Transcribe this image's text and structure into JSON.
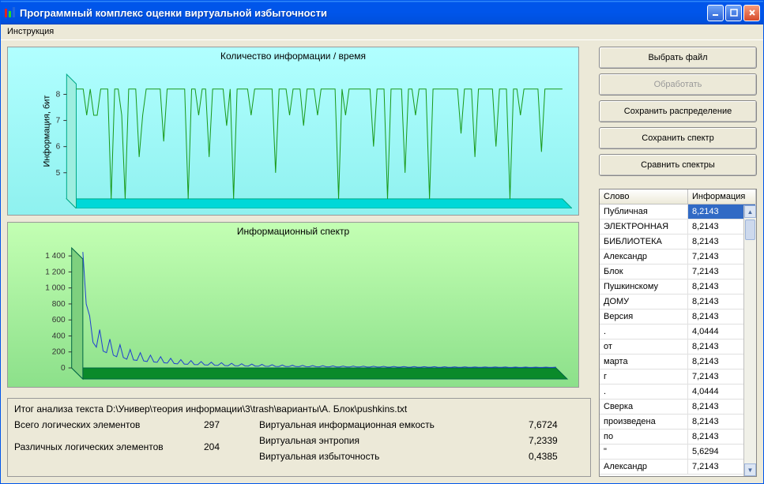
{
  "window": {
    "title": "Программный комплекс оценки виртуальной избыточности"
  },
  "menu": {
    "item1": "Инструкция"
  },
  "chart1": {
    "title": "Количество информации / время",
    "ylabel": "Информация, бит",
    "yticks": [
      "5",
      "6",
      "7",
      "8"
    ]
  },
  "chart2": {
    "title": "Информационный спектр",
    "yticks": [
      "0",
      "200",
      "400",
      "600",
      "800",
      "1 000",
      "1 200",
      "1 400"
    ]
  },
  "chart_data": [
    {
      "type": "line",
      "title": "Количество информации / время",
      "ylabel": "Информация, бит",
      "ylim": [
        4.0,
        8.4
      ],
      "values": [
        8.2,
        8.2,
        8.2,
        7.2,
        8.2,
        7.2,
        7.2,
        8.2,
        8.2,
        8.2,
        4.0,
        8.2,
        8.2,
        7.2,
        4.0,
        8.2,
        8.2,
        8.2,
        5.6,
        7.2,
        8.2,
        8.2,
        8.2,
        8.2,
        8.2,
        6.2,
        8.2,
        8.2,
        8.2,
        8.2,
        8.2,
        8.2,
        4.0,
        8.2,
        8.2,
        7.2,
        8.2,
        8.2,
        5.6,
        8.2,
        8.2,
        8.2,
        8.2,
        6.8,
        8.2,
        4.0,
        8.2,
        8.2,
        8.2,
        8.2,
        7.2,
        8.2,
        8.2,
        8.2,
        8.2,
        8.2,
        8.2,
        5.0,
        8.2,
        8.2,
        8.2,
        7.2,
        8.2,
        8.2,
        8.2,
        6.8,
        8.2,
        8.2,
        8.2,
        7.2,
        8.2,
        8.2,
        8.2,
        8.2,
        8.2,
        4.0,
        8.2,
        7.2,
        8.2,
        8.2,
        8.2,
        8.2,
        8.2,
        8.2,
        8.2,
        6.0,
        8.2,
        8.2,
        8.2,
        4.0,
        8.2,
        8.2,
        8.2,
        8.2,
        5.0,
        8.2,
        8.2,
        7.2,
        8.2,
        8.2,
        8.2,
        4.0,
        8.2,
        8.2,
        8.2,
        8.2,
        8.2,
        8.2,
        8.2,
        8.2,
        6.5,
        8.2,
        8.2,
        8.2,
        5.6,
        8.2,
        8.2,
        8.2,
        8.2,
        8.2,
        6.0,
        8.2,
        8.2,
        8.2,
        4.0,
        8.2,
        8.2,
        7.2,
        8.2,
        8.2,
        8.2,
        8.2,
        8.2,
        5.8,
        8.2,
        8.2,
        8.2,
        8.2,
        8.2,
        8.2
      ]
    },
    {
      "type": "line",
      "title": "Информационный спектр",
      "ylim": [
        0,
        1500
      ],
      "values": [
        1450,
        800,
        650,
        320,
        260,
        480,
        210,
        190,
        360,
        160,
        140,
        290,
        130,
        110,
        230,
        100,
        95,
        190,
        88,
        80,
        160,
        75,
        70,
        140,
        65,
        60,
        120,
        55,
        50,
        105,
        48,
        45,
        92,
        42,
        40,
        80,
        38,
        36,
        72,
        34,
        32,
        65,
        30,
        28,
        58,
        27,
        26,
        52,
        25,
        24,
        48,
        23,
        22,
        44,
        21,
        20,
        40,
        19,
        18,
        37,
        18,
        17,
        34,
        17,
        16,
        32,
        16,
        15,
        30,
        15,
        14,
        28,
        14,
        14,
        26,
        13,
        13,
        24,
        13,
        12,
        23,
        12,
        12,
        22,
        11,
        11,
        21,
        11,
        11,
        20,
        10,
        10,
        19,
        10,
        10,
        18,
        10,
        9,
        17,
        9,
        9,
        16,
        9,
        9,
        16,
        8,
        8,
        15,
        8,
        8,
        14,
        8,
        8,
        14,
        7,
        7,
        13,
        7,
        7,
        13,
        7,
        7,
        12,
        7,
        7,
        12,
        6,
        6,
        11,
        6,
        6,
        11,
        6,
        6,
        10,
        6,
        6,
        10,
        6,
        6,
        10
      ]
    }
  ],
  "buttons": {
    "select": "Выбрать файл",
    "process": "Обработать",
    "saveDist": "Сохранить распределение",
    "saveSpec": "Сохранить спектр",
    "compare": "Сравнить спектры"
  },
  "table": {
    "h1": "Слово",
    "h2": "Информация",
    "rows": [
      {
        "w": "Публичная",
        "i": "8,2143",
        "sel": true
      },
      {
        "w": "ЭЛЕКТРОННАЯ",
        "i": "8,2143"
      },
      {
        "w": "БИБЛИОТЕКА",
        "i": "8,2143"
      },
      {
        "w": "Александр",
        "i": "7,2143"
      },
      {
        "w": "Блок",
        "i": "7,2143"
      },
      {
        "w": "Пушкинскому",
        "i": "8,2143"
      },
      {
        "w": "ДОМУ",
        "i": "8,2143"
      },
      {
        "w": "Версия",
        "i": "8,2143"
      },
      {
        "w": ".",
        "i": "4,0444"
      },
      {
        "w": "от",
        "i": "8,2143"
      },
      {
        "w": "марта",
        "i": "8,2143"
      },
      {
        "w": "г",
        "i": "7,2143"
      },
      {
        "w": ".",
        "i": "4,0444"
      },
      {
        "w": "Сверка",
        "i": "8,2143"
      },
      {
        "w": "произведена",
        "i": "8,2143"
      },
      {
        "w": "по",
        "i": "8,2143"
      },
      {
        "w": "\"",
        "i": "5,6294"
      },
      {
        "w": "Александр",
        "i": "7,2143"
      }
    ]
  },
  "summary": {
    "title": "Итог анализа текста D:\\Универ\\теория информации\\3\\trash\\варианты\\А. Блок\\pushkins.txt",
    "l1": "Всего логических элементов",
    "v1": "297",
    "l2": "Различных логических элементов",
    "v2": "204",
    "r1": "Виртуальная информационная емкость",
    "rv1": "7,6724",
    "r2": "Виртуальная энтропия",
    "rv2": "7,2339",
    "r3": "Виртуальная избыточность",
    "rv3": "0,4385"
  }
}
